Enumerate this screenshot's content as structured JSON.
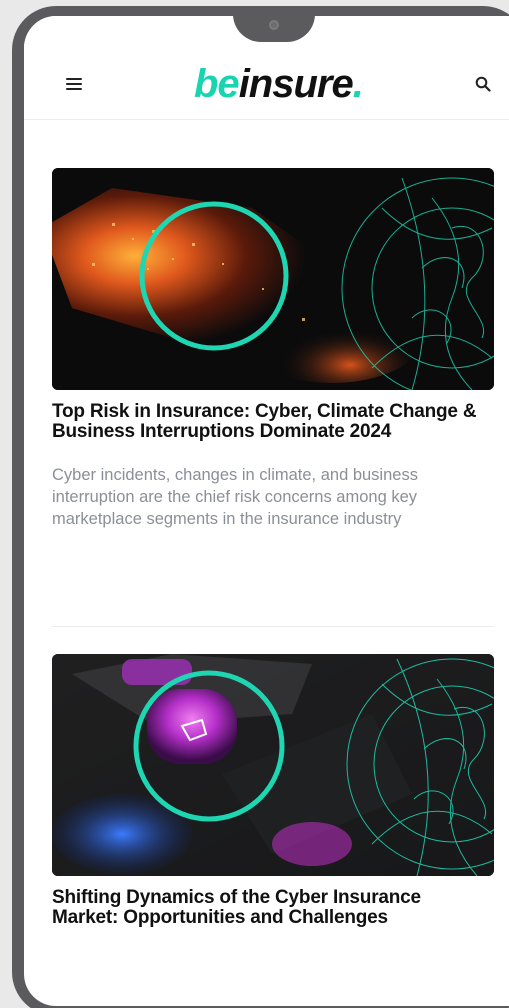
{
  "header": {
    "logo_prefix": "be",
    "logo_suffix": "insure",
    "logo_dot": ".",
    "menu_icon": "hamburger-menu-icon",
    "search_icon": "search-icon"
  },
  "articles": [
    {
      "title": "Top Risk in Insurance: Cyber, Climate Change & Business Interruptions Dominate 2024",
      "excerpt": "Cyber incidents, changes in climate, and business interruption are the chief risk concerns among key marketplace segments in the insurance industry"
    },
    {
      "title": "Shifting Dynamics of the Cyber Insurance Market: Opportunities and Challenges",
      "excerpt": ""
    }
  ],
  "colors": {
    "accent": "#19d4b0",
    "text": "#111111",
    "excerpt": "#8b8f96",
    "frame": "#5b5b5d",
    "background": "#e9e9ea"
  }
}
